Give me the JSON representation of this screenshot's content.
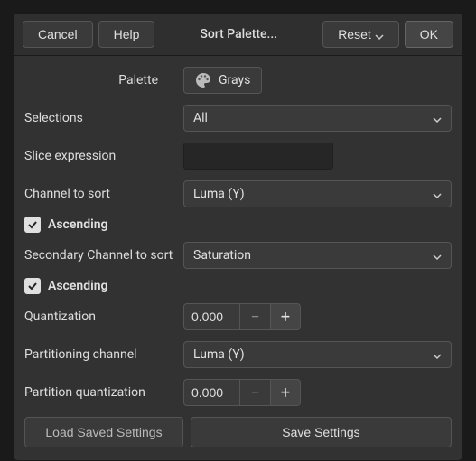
{
  "header": {
    "cancel": "Cancel",
    "help": "Help",
    "title": "Sort Palette...",
    "reset": "Reset",
    "ok": "OK"
  },
  "fields": {
    "palette_label": "Palette",
    "palette_value": "Grays",
    "selections_label": "Selections",
    "selections_value": "All",
    "slice_label": "Slice expression",
    "slice_value": "",
    "channel_label": "Channel to sort",
    "channel_value": "Luma (Y)",
    "ascending1": "Ascending",
    "secondary_label": "Secondary Channel to sort",
    "secondary_value": "Saturation",
    "ascending2": "Ascending",
    "quantization_label": "Quantization",
    "quantization_value": "0.000",
    "partitioning_label": "Partitioning channel",
    "partitioning_value": "Luma (Y)",
    "partition_q_label": "Partition quantization",
    "partition_q_value": "0.000"
  },
  "footer": {
    "load": "Load Saved Settings",
    "save": "Save Settings"
  },
  "glyphs": {
    "minus": "−",
    "plus": "+"
  }
}
